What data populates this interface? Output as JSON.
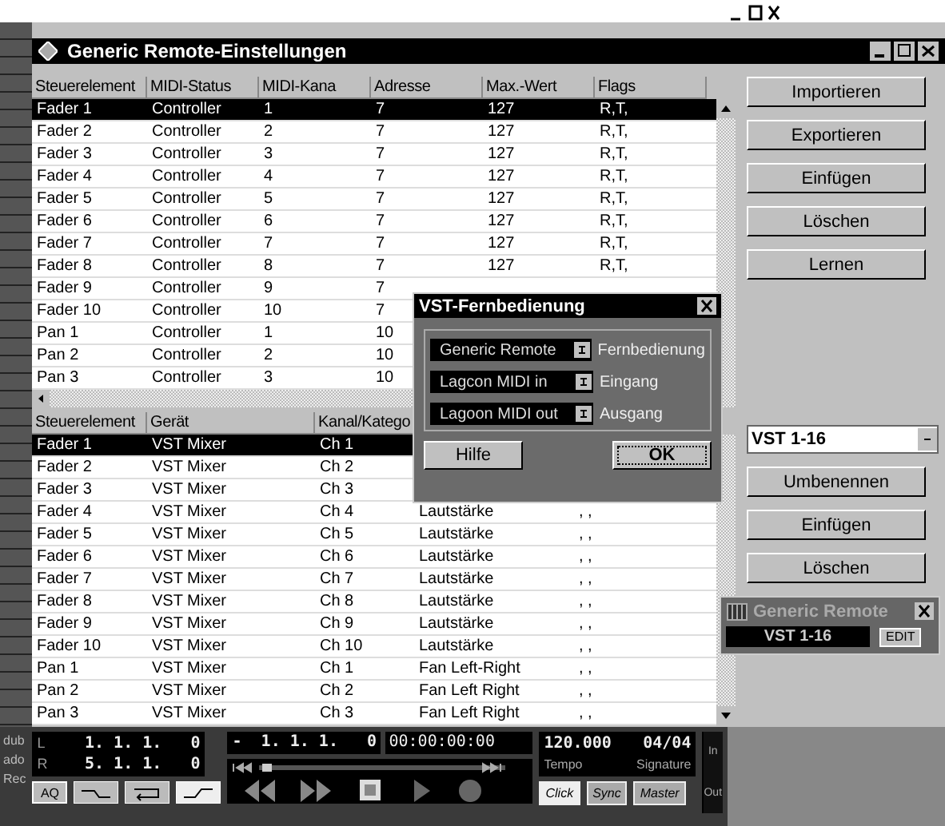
{
  "window": {
    "title": "Generic Remote-Einstellungen"
  },
  "controls_table": {
    "columns": [
      "Steuerelement",
      "MIDI-Status",
      "MIDI-Kana",
      "Adresse",
      "Max.-Wert",
      "Flags"
    ],
    "rows": [
      {
        "cells": [
          "Fader 1",
          "Controller",
          "1",
          "7",
          "127",
          "R,T,"
        ],
        "selected": true
      },
      {
        "cells": [
          "Fader 2",
          "Controller",
          "2",
          "7",
          "127",
          "R,T,"
        ],
        "selected": false
      },
      {
        "cells": [
          "Fader 3",
          "Controller",
          "3",
          "7",
          "127",
          "R,T,"
        ],
        "selected": false
      },
      {
        "cells": [
          "Fader 4",
          "Controller",
          "4",
          "7",
          "127",
          "R,T,"
        ],
        "selected": false
      },
      {
        "cells": [
          "Fader 5",
          "Controller",
          "5",
          "7",
          "127",
          "R,T,"
        ],
        "selected": false
      },
      {
        "cells": [
          "Fader 6",
          "Controller",
          "6",
          "7",
          "127",
          "R,T,"
        ],
        "selected": false
      },
      {
        "cells": [
          "Fader 7",
          "Controller",
          "7",
          "7",
          "127",
          "R,T,"
        ],
        "selected": false
      },
      {
        "cells": [
          "Fader 8",
          "Controller",
          "8",
          "7",
          "127",
          "R,T,"
        ],
        "selected": false
      },
      {
        "cells": [
          "Fader 9",
          "Controller",
          "9",
          "7"
        ],
        "selected": false
      },
      {
        "cells": [
          "Fader 10",
          "Controller",
          "10",
          "7"
        ],
        "selected": false
      },
      {
        "cells": [
          "Pan 1",
          "Controller",
          "1",
          "10"
        ],
        "selected": false
      },
      {
        "cells": [
          "Pan 2",
          "Controller",
          "2",
          "10"
        ],
        "selected": false
      },
      {
        "cells": [
          "Pan 3",
          "Controller",
          "3",
          "10"
        ],
        "selected": false
      }
    ]
  },
  "device_table": {
    "columns": [
      "Steuerelement",
      "Gerät",
      "Kanal/Katego"
    ],
    "rows": [
      {
        "cells": [
          "Fader 1",
          "VST Mixer",
          "Ch 1"
        ],
        "selected": true
      },
      {
        "cells": [
          "Fader 2",
          "VST Mixer",
          "Ch 2"
        ],
        "selected": false
      },
      {
        "cells": [
          "Fader 3",
          "VST Mixer",
          "Ch 3"
        ],
        "selected": false
      },
      {
        "cells": [
          "Fader 4",
          "VST Mixer",
          "Ch 4",
          "Lautstärke",
          ", ,"
        ],
        "selected": false
      },
      {
        "cells": [
          "Fader 5",
          "VST Mixer",
          "Ch 5",
          "Lautstärke",
          ", ,"
        ],
        "selected": false
      },
      {
        "cells": [
          "Fader 6",
          "VST Mixer",
          "Ch 6",
          "Lautstärke",
          ", ,"
        ],
        "selected": false
      },
      {
        "cells": [
          "Fader 7",
          "VST Mixer",
          "Ch 7",
          "Lautstärke",
          ", ,"
        ],
        "selected": false
      },
      {
        "cells": [
          "Fader 8",
          "VST Mixer",
          "Ch 8",
          "Lautstärke",
          ", ,"
        ],
        "selected": false
      },
      {
        "cells": [
          "Fader 9",
          "VST Mixer",
          "Ch 9",
          "Lautstärke",
          ", ,"
        ],
        "selected": false
      },
      {
        "cells": [
          "Fader 10",
          "VST Mixer",
          "Ch 10",
          "Lautstärke",
          ", ,"
        ],
        "selected": false
      },
      {
        "cells": [
          "Pan 1",
          "VST Mixer",
          "Ch 1",
          "Fan Left-Right",
          ", ,"
        ],
        "selected": false
      },
      {
        "cells": [
          "Pan 2",
          "VST Mixer",
          "Ch 2",
          "Fan Left Right",
          ", ,"
        ],
        "selected": false
      },
      {
        "cells": [
          "Pan 3",
          "VST Mixer",
          "Ch 3",
          "Fan Left Right",
          ", ,"
        ],
        "selected": false
      }
    ]
  },
  "side_buttons": [
    "Importieren",
    "Exportieren",
    "Einfügen",
    "Löschen",
    "Lernen"
  ],
  "bank_select": {
    "value": "VST 1-16"
  },
  "bank_buttons": [
    "Umbenennen",
    "Einfügen",
    "Löschen"
  ],
  "dialog": {
    "title": "VST-Fernbedienung",
    "fields": [
      {
        "value": "Generic Remote",
        "label": "Fernbedienung"
      },
      {
        "value": "Lagcon MIDI in",
        "label": "Eingang"
      },
      {
        "value": "Lagoon MIDI out",
        "label": "Ausgang"
      }
    ],
    "buttons": [
      {
        "label": "Hilfe",
        "default": false
      },
      {
        "label": "OK",
        "default": true
      }
    ]
  },
  "mini_window": {
    "title": "Generic Remote",
    "select": "VST 1-16",
    "button": "EDIT"
  },
  "transport": {
    "left_labels": [
      "dub",
      "ado",
      "Rec"
    ],
    "locators": [
      {
        "label": "L",
        "value": "1. 1. 1.   0"
      },
      {
        "label": "R",
        "value": "5. 1. 1.   0"
      }
    ],
    "aq_button": "AQ",
    "position": "-  1. 1. 1.   0",
    "time": "00:00:00:00",
    "tempo": "120.000",
    "signature": "04/04",
    "tempo_label": "Tempo",
    "signature_label": "Signature",
    "mode_buttons": [
      "Click",
      "Sync",
      "Master"
    ],
    "meter_labels": [
      "In",
      "Out"
    ]
  }
}
